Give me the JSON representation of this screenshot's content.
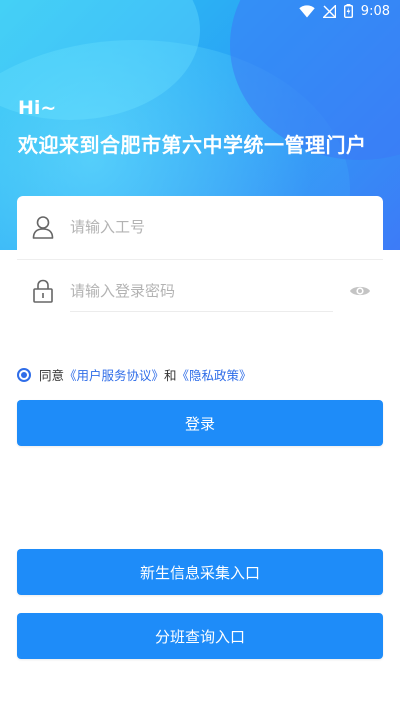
{
  "status_bar": {
    "time": "9:08"
  },
  "header": {
    "greeting": "Hi~",
    "welcome": "欢迎来到合肥市第六中学统一管理门户"
  },
  "login": {
    "username_placeholder": "请输入工号",
    "password_placeholder": "请输入登录密码",
    "username_value": "",
    "password_value": ""
  },
  "agreement": {
    "prefix": "同意",
    "user_agreement": "《用户服务协议》",
    "conjunction": "和",
    "privacy_policy": "《隐私政策》",
    "checked": true
  },
  "buttons": {
    "login": "登录",
    "new_student": "新生信息采集入口",
    "class_query": "分班查询入口"
  },
  "colors": {
    "primary": "#1e8cf9",
    "link": "#2f6de8",
    "hero_start": "#2ec7f2",
    "hero_end": "#3d7bf7"
  }
}
